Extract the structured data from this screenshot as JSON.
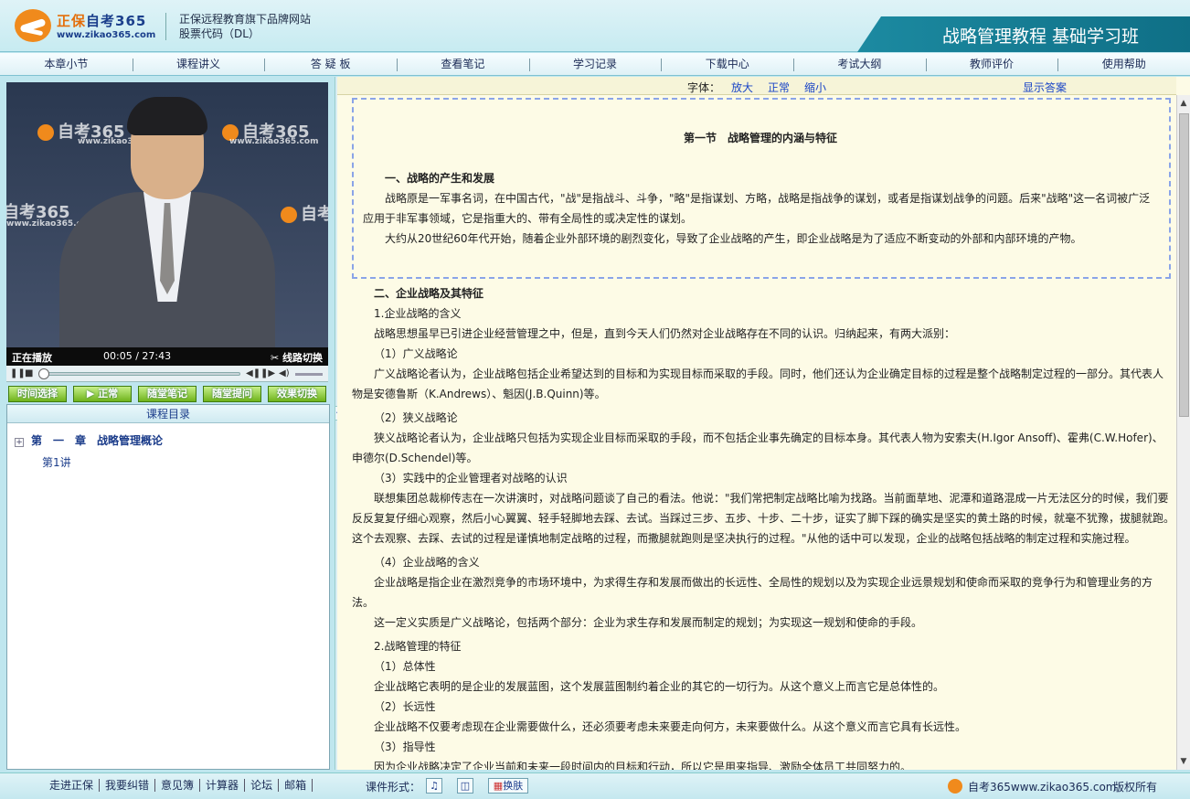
{
  "header": {
    "logo_text_a": "正保",
    "logo_text_b": "自考365",
    "logo_url": "www.zikao365.com",
    "brand_line1": "正保远程教育旗下品牌网站",
    "brand_line2": "股票代码（DL）",
    "course_title": "战略管理教程 基础学习班"
  },
  "nav": [
    "本章小节",
    "课程讲义",
    "答 疑 板",
    "查看笔记",
    "学习记录",
    "下载中心",
    "考试大纲",
    "教师评价",
    "使用帮助"
  ],
  "video": {
    "watermark": "自考365",
    "watermark_url": "www.zikao365.com",
    "status": "正在播放",
    "time": "00:05 / 27:43",
    "switch_label": "线路切换",
    "progress_fraction": 0.003
  },
  "player_buttons": [
    "时间选择",
    "正常",
    "随堂笔记",
    "随堂提问",
    "效果切换"
  ],
  "catalog": {
    "title": "课程目录",
    "chapter": "第　一　章　战略管理概论",
    "lecture": "第1讲"
  },
  "toolbar": {
    "font_label": "字体：",
    "enlarge": "放大",
    "normal": "正常",
    "shrink": "缩小",
    "show_answer": "显示答案"
  },
  "content": {
    "section_title": "第一节　战略管理的内涵与特征",
    "h1": "一、战略的产生和发展",
    "p1a": "战略原是一军事名词，在中国古代，\"战\"是指战斗、斗争，\"略\"是指谋划、方略，战略是指战争的谋划，或者是指谋划战争的问题。后来\"战略\"这一名词被广泛",
    "p1b": "应用于非军事领域，它是指重大的、带有全局性的或决定性的谋划。",
    "p2": "大约从20世纪60年代开始，随着企业外部环境的剧烈变化，导致了企业战略的产生，即企业战略是为了适应不断变动的外部和内部环境的产物。",
    "h2": "二、企业战略及其特征",
    "s1": "1.企业战略的含义",
    "p3": "战略思想虽早已引进企业经营管理之中，但是，直到今天人们仍然对企业战略存在不同的认识。归纳起来，有两大派别：",
    "s1a": "（1）广义战略论",
    "p4a": "广义战略论者认为，企业战略包括企业希望达到的目标和为实现目标而采取的手段。同时，他们还认为企业确定目标的过程是整个战略制定过程的一部分。其代表人",
    "p4b": "物是安德鲁斯（K.Andrews）、魁因(J.B.Quinn)等。",
    "s1b": "（2）狭义战略论",
    "p5a": "狭义战略论者认为，企业战略只包括为实现企业目标而采取的手段，而不包括企业事先确定的目标本身。其代表人物为安索夫(H.Igor Ansoff)、霍弗(C.W.Hofer)、",
    "p5b": "申德尔(D.Schendel)等。",
    "s1c": "（3）实践中的企业管理者对战略的认识",
    "p6a": "联想集团总裁柳传志在一次讲演时，对战略问题谈了自己的看法。他说：\"我们常把制定战略比喻为找路。当前面草地、泥潭和道路混成一片无法区分的时候，我们要",
    "p6b": "反反复复仔细心观察，然后小心翼翼、轻手轻脚地去踩、去试。当踩过三步、五步、十步、二十步，证实了脚下踩的确实是坚实的黄土路的时候，就毫不犹豫，拔腿就跑。",
    "p6c": "这个去观察、去踩、去试的过程是谨慎地制定战略的过程，而撒腿就跑则是坚决执行的过程。\"从他的话中可以发现，企业的战略包括战略的制定过程和实施过程。",
    "s1d": "（4）企业战略的含义",
    "p7a": "企业战略是指企业在激烈竞争的市场环境中，为求得生存和发展而做出的长远性、全局性的规划以及为实现企业远景规划和使命而采取的竞争行为和管理业务的方",
    "p7b": "法。",
    "p8": "这一定义实质是广义战略论，包括两个部分：企业为求生存和发展而制定的规划；为实现这一规划和使命的手段。",
    "s2": "2.战略管理的特征",
    "s2a": "（1）总体性",
    "p9": "企业战略它表明的是企业的发展蓝图，这个发展蓝图制约着企业的其它的一切行为。从这个意义上而言它是总体性的。",
    "s2b": "（2）长远性",
    "p10": "企业战略不仅要考虑现在企业需要做什么，还必须要考虑未来要走向何方，未来要做什么。从这个意义而言它具有长远性。",
    "s2c": "（3）指导性",
    "p11": "因为企业战略决定了企业当前和未来一段时间内的目标和行动，所以它是用来指导、激励全体员工共同努力的。"
  },
  "footer": {
    "links": [
      "走进正保",
      "我要纠错",
      "意见簿",
      "计算器",
      "论坛",
      "邮箱"
    ],
    "form_label": "课件形式：",
    "skin_label": "换肤",
    "site": "自考365www.zikao365.com",
    "copyright": "版权所有"
  },
  "colors": {
    "accent": "#f08a1c",
    "banner": "#1c8aa1",
    "content_bg": "#fdfbe6",
    "link": "#1a45c6"
  }
}
